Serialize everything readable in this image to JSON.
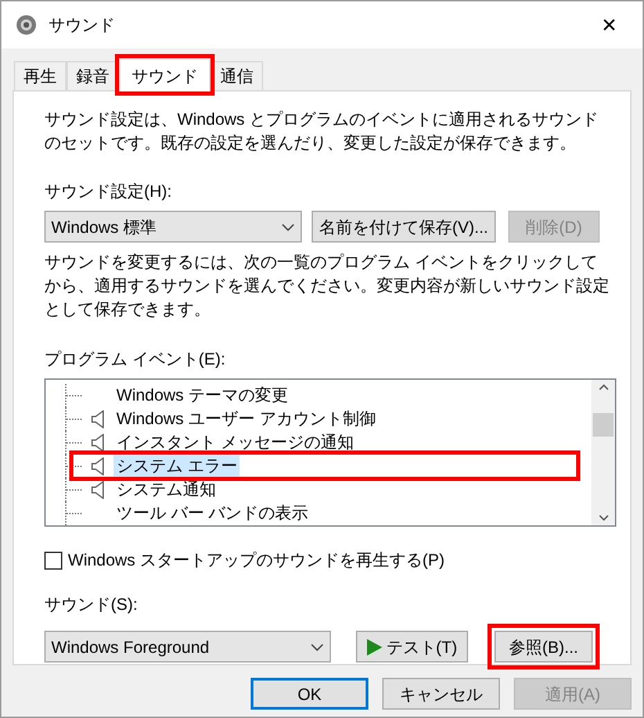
{
  "window": {
    "title": "サウンド",
    "close": "✕"
  },
  "tabs": [
    {
      "label": "再生",
      "selected": false,
      "highlighted": false
    },
    {
      "label": "録音",
      "selected": false,
      "highlighted": false
    },
    {
      "label": "サウンド",
      "selected": true,
      "highlighted": true
    },
    {
      "label": "通信",
      "selected": false,
      "highlighted": false
    }
  ],
  "description": "サウンド設定は、Windows とプログラムのイベントに適用されるサウンドのセットです。既存の設定を選んだり、変更した設定が保存できます。",
  "scheme": {
    "label": "サウンド設定(H):",
    "value": "Windows 標準",
    "buttons": [
      {
        "label": "名前を付けて保存(V)...",
        "disabled": false
      },
      {
        "label": "削除(D)",
        "disabled": true
      }
    ]
  },
  "instruction": "サウンドを変更するには、次の一覧のプログラム イベントをクリックしてから、適用するサウンドを選んでください。変更内容が新しいサウンド設定として保存できます。",
  "events": {
    "label": "プログラム イベント(E):",
    "items": [
      {
        "label": "Windows テーマの変更",
        "has_sound": false,
        "selected": false,
        "highlighted": false
      },
      {
        "label": "Windows ユーザー アカウント制御",
        "has_sound": true,
        "selected": false,
        "highlighted": false
      },
      {
        "label": "インスタント メッセージの通知",
        "has_sound": true,
        "selected": false,
        "highlighted": false
      },
      {
        "label": "システム エラー",
        "has_sound": true,
        "selected": true,
        "highlighted": true
      },
      {
        "label": "システム通知",
        "has_sound": true,
        "selected": false,
        "highlighted": false
      },
      {
        "label": "ツール バー バンドの表示",
        "has_sound": false,
        "selected": false,
        "highlighted": false
      }
    ]
  },
  "startup": {
    "label": "Windows スタートアップのサウンドを再生する(P)",
    "checked": false
  },
  "sound": {
    "label": "サウンド(S):",
    "value": "Windows Foreground"
  },
  "test_button": {
    "label": "テスト(T)"
  },
  "browse_button": {
    "label": "参照(B)...",
    "highlighted": true
  },
  "footer_buttons": [
    {
      "label": "OK",
      "disabled": false,
      "default": true
    },
    {
      "label": "キャンセル",
      "disabled": false,
      "default": false
    },
    {
      "label": "適用(A)",
      "disabled": true,
      "default": false
    }
  ]
}
